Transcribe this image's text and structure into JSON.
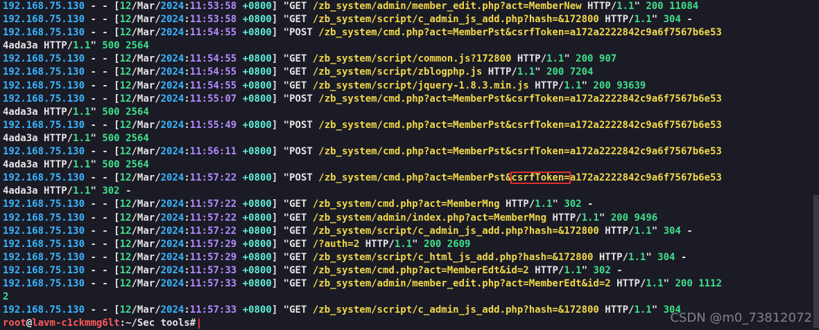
{
  "colors": {
    "background": "#1b1b26",
    "ip": "#3ab6ff",
    "green": "#3fe08a",
    "purple": "#b48cff",
    "cyan": "#5ff0d8",
    "yellow": "#f1d94a",
    "highlight_box": "#e0302d"
  },
  "log": [
    {
      "ip": "192.168.75.130",
      "day": "12",
      "mon": "Mar",
      "yr": "2024",
      "time": "11:53:58",
      "tz": "+0800",
      "method": "GET",
      "url": "/zb_system/admin/member_edit.php?act=MemberNew",
      "proto": "HTTP/1.1",
      "status": "200",
      "size": "11084"
    },
    {
      "ip": "192.168.75.130",
      "day": "12",
      "mon": "Mar",
      "yr": "2024",
      "time": "11:53:58",
      "tz": "+0800",
      "method": "GET",
      "url": "/zb_system/script/c_admin_js_add.php?hash=&172800",
      "proto": "HTTP/1.1",
      "status": "304",
      "size": "-"
    },
    {
      "ip": "192.168.75.130",
      "day": "12",
      "mon": "Mar",
      "yr": "2024",
      "time": "11:54:55",
      "tz": "+0800",
      "method": "POST",
      "url": "/zb_system/cmd.php?act=MemberPst&csrfToken=a172a2222842c9a6f7567b6e53",
      "cont": "4ada3a",
      "proto": "HTTP/1.1",
      "status": "500",
      "size": "2564"
    },
    {
      "ip": "192.168.75.130",
      "day": "12",
      "mon": "Mar",
      "yr": "2024",
      "time": "11:54:55",
      "tz": "+0800",
      "method": "GET",
      "url": "/zb_system/script/common.js?172800",
      "proto": "HTTP/1.1",
      "status": "200",
      "size": "907"
    },
    {
      "ip": "192.168.75.130",
      "day": "12",
      "mon": "Mar",
      "yr": "2024",
      "time": "11:54:55",
      "tz": "+0800",
      "method": "GET",
      "url": "/zb_system/script/zblogphp.js",
      "proto": "HTTP/1.1",
      "status": "200",
      "size": "7204"
    },
    {
      "ip": "192.168.75.130",
      "day": "12",
      "mon": "Mar",
      "yr": "2024",
      "time": "11:54:55",
      "tz": "+0800",
      "method": "GET",
      "url": "/zb_system/script/jquery-1.8.3.min.js",
      "proto": "HTTP/1.1",
      "status": "200",
      "size": "93639"
    },
    {
      "ip": "192.168.75.130",
      "day": "12",
      "mon": "Mar",
      "yr": "2024",
      "time": "11:55:07",
      "tz": "+0800",
      "method": "POST",
      "url": "/zb_system/cmd.php?act=MemberPst&csrfToken=a172a2222842c9a6f7567b6e53",
      "cont": "4ada3a",
      "proto": "HTTP/1.1",
      "status": "500",
      "size": "2564"
    },
    {
      "ip": "192.168.75.130",
      "day": "12",
      "mon": "Mar",
      "yr": "2024",
      "time": "11:55:49",
      "tz": "+0800",
      "method": "POST",
      "url": "/zb_system/cmd.php?act=MemberPst&csrfToken=a172a2222842c9a6f7567b6e53",
      "cont": "4ada3a",
      "proto": "HTTP/1.1",
      "status": "500",
      "size": "2564"
    },
    {
      "ip": "192.168.75.130",
      "day": "12",
      "mon": "Mar",
      "yr": "2024",
      "time": "11:56:11",
      "tz": "+0800",
      "method": "POST",
      "url": "/zb_system/cmd.php?act=MemberPst&csrfToken=a172a2222842c9a6f7567b6e53",
      "cont": "4ada3a",
      "proto": "HTTP/1.1",
      "status": "500",
      "size": "2564"
    },
    {
      "ip": "192.168.75.130",
      "day": "12",
      "mon": "Mar",
      "yr": "2024",
      "time": "11:57:22",
      "tz": "+0800",
      "method": "POST",
      "url": "/zb_system/cmd.php?act=MemberPst&csrfToken=a172a2222842c9a6f7567b6e53",
      "cont": "4ada3a",
      "proto": "HTTP/1.1",
      "status": "302",
      "size": "-",
      "highlight": "csrfToken="
    },
    {
      "ip": "192.168.75.130",
      "day": "12",
      "mon": "Mar",
      "yr": "2024",
      "time": "11:57:22",
      "tz": "+0800",
      "method": "GET",
      "url": "/zb_system/cmd.php?act=MemberMng",
      "proto": "HTTP/1.1",
      "status": "302",
      "size": "-"
    },
    {
      "ip": "192.168.75.130",
      "day": "12",
      "mon": "Mar",
      "yr": "2024",
      "time": "11:57:22",
      "tz": "+0800",
      "method": "GET",
      "url": "/zb_system/admin/index.php?act=MemberMng",
      "proto": "HTTP/1.1",
      "status": "200",
      "size": "9496"
    },
    {
      "ip": "192.168.75.130",
      "day": "12",
      "mon": "Mar",
      "yr": "2024",
      "time": "11:57:22",
      "tz": "+0800",
      "method": "GET",
      "url": "/zb_system/script/c_admin_js_add.php?hash=&172800",
      "proto": "HTTP/1.1",
      "status": "304",
      "size": "-"
    },
    {
      "ip": "192.168.75.130",
      "day": "12",
      "mon": "Mar",
      "yr": "2024",
      "time": "11:57:29",
      "tz": "+0800",
      "method": "GET",
      "url": "/?auth=2",
      "proto": "HTTP/1.1",
      "status": "200",
      "size": "2609"
    },
    {
      "ip": "192.168.75.130",
      "day": "12",
      "mon": "Mar",
      "yr": "2024",
      "time": "11:57:29",
      "tz": "+0800",
      "method": "GET",
      "url": "/zb_system/script/c_html_js_add.php?hash=&172800",
      "proto": "HTTP/1.1",
      "status": "304",
      "size": "-"
    },
    {
      "ip": "192.168.75.130",
      "day": "12",
      "mon": "Mar",
      "yr": "2024",
      "time": "11:57:33",
      "tz": "+0800",
      "method": "GET",
      "url": "/zb_system/cmd.php?act=MemberEdt&id=2",
      "proto": "HTTP/1.1",
      "status": "302",
      "size": "-"
    },
    {
      "ip": "192.168.75.130",
      "day": "12",
      "mon": "Mar",
      "yr": "2024",
      "time": "11:57:33",
      "tz": "+0800",
      "method": "GET",
      "url": "/zb_system/admin/member_edit.php?act=MemberEdt&id=2",
      "proto": "HTTP/1.1",
      "status": "200",
      "size": "11122",
      "size_first": "1112",
      "size_wrap": "2"
    },
    {
      "ip": "192.168.75.130",
      "day": "12",
      "mon": "Mar",
      "yr": "2024",
      "time": "11:57:33",
      "tz": "+0800",
      "method": "GET",
      "url": "/zb_system/script/c_admin_js_add.php?hash=&172800",
      "proto": "HTTP/1.1",
      "status": "304",
      "size": ""
    }
  ],
  "prompt": {
    "user": "root",
    "at": "@",
    "host": "lavm-c1ckmmg6lt",
    "path": ":~/Sec tools#"
  },
  "watermark": "CSDN @m0_73812072"
}
